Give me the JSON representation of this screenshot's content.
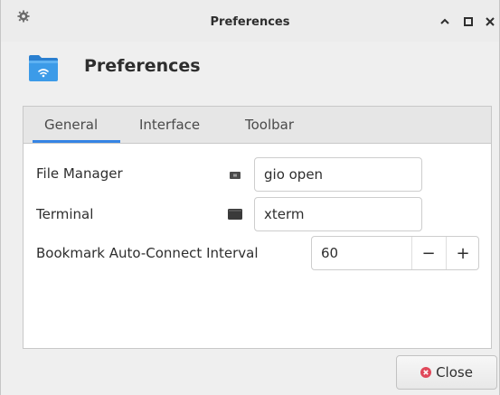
{
  "window": {
    "title": "Preferences"
  },
  "header": {
    "title": "Preferences"
  },
  "tabs": [
    {
      "label": "General",
      "active": true
    },
    {
      "label": "Interface",
      "active": false
    },
    {
      "label": "Toolbar",
      "active": false
    }
  ],
  "general": {
    "file_manager": {
      "label": "File Manager",
      "value": "gio open",
      "icon": "file-manager-icon"
    },
    "terminal": {
      "label": "Terminal",
      "value": "xterm",
      "icon": "terminal-icon"
    },
    "bookmark_interval": {
      "label": "Bookmark Auto-Connect Interval",
      "value": "60",
      "minus": "−",
      "plus": "+"
    }
  },
  "footer": {
    "close_label": "Close"
  },
  "colors": {
    "accent": "#3584e4",
    "folder": "#3c9be8",
    "close_icon": "#e0485a"
  }
}
